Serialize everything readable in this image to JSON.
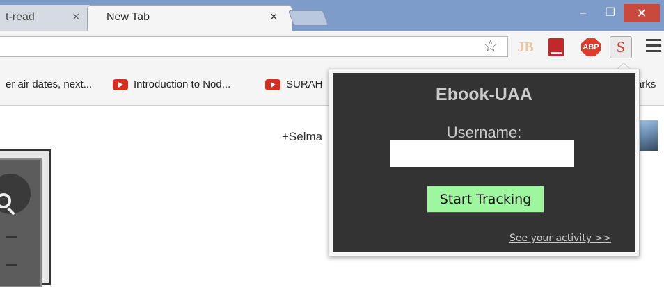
{
  "browser": {
    "tabs": [
      {
        "label": "t-read",
        "close": "×"
      },
      {
        "label": "New Tab",
        "close": "×"
      }
    ],
    "window_controls": {
      "minimize": "–",
      "maximize": "❐",
      "close": "✕"
    },
    "star": "☆",
    "extensions": {
      "jb": "JB",
      "abp": "ABP",
      "s": "S"
    }
  },
  "bookmarks": [
    {
      "label": "er air dates, next..."
    },
    {
      "label": "Introduction to Nod..."
    },
    {
      "label": "SURAH"
    },
    {
      "label": "arks"
    }
  ],
  "page": {
    "user_link": "+Selma"
  },
  "popup": {
    "title": "Ebook-UAA",
    "username_label": "Username:",
    "username_value": "",
    "button_label": "Start Tracking",
    "activity_link": "See your activity >>"
  },
  "colors": {
    "titlebar": "#7d9cc9",
    "popup_bg": "#333333",
    "button_bg": "#9ef79e",
    "close_btn": "#c9493d"
  }
}
